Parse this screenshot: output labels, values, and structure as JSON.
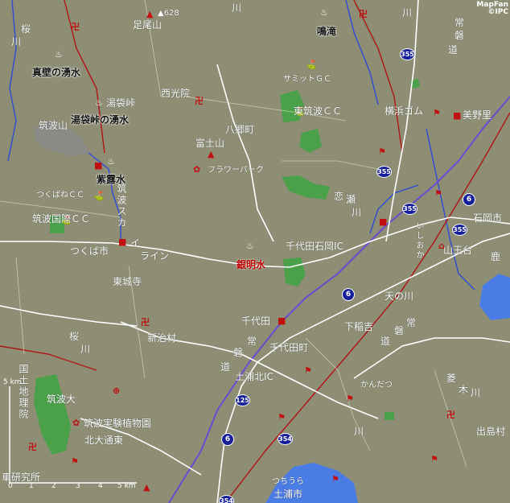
{
  "credit": {
    "line1": "MapFan",
    "line2": "©IPC"
  },
  "roads": {
    "r355a": "355",
    "r355b": "355",
    "r355c": "355",
    "r355d": "355",
    "r6a": "6",
    "r6b": "6",
    "r6c": "6",
    "r354": "354",
    "r354b": "354",
    "r125": "125"
  },
  "places": {
    "ashio": "足尾山",
    "peak628": "▲628",
    "naruto": "鳴滝",
    "sakuragawa1": "桜",
    "sakuragawa2": "川",
    "kawa_top": "川",
    "makabe": "真壁の湧水",
    "yubukuro": "湯袋峠",
    "yubukuro_spring": "湯袋峠の湧水",
    "tsukubasan": "筑波山",
    "saikouin": "西光院",
    "summit_cc": "サミットＧＣ",
    "higashi_tsukuba_cc": "東筑波ＣＣ",
    "yokohama_rubber": "横浜ゴム",
    "minori": "美野里",
    "yasato": "八郷町",
    "fujisan": "富士山",
    "flowerpark": "フラワーパーク",
    "shishisui": "紫露水",
    "tsukubane_cc": "つくばねＣＣ",
    "tsukuba_kokusai_cc": "筑波国際ＣＣ",
    "tsukuba_line": "つくば市",
    "higashijoji": "東城寺",
    "koise": "恋",
    "koise2": "瀬",
    "koise3": "川",
    "ishioka_city": "石岡市",
    "sannoudai": "山王台",
    "kashima": "鹿",
    "ishioka_ic": "千代田石岡IC",
    "ginmeisui": "銀明水",
    "tennokawa": "天の川",
    "chiyoda": "千代田",
    "chiyoda_town": "千代田町",
    "shimoinayoshi": "下稲吉",
    "niiharu": "新治村",
    "tsuchiura_kita_ic": "土浦北IC",
    "kandatsu": "かんだつ",
    "hishiki1": "菱",
    "hishiki2": "木",
    "hishiki3": "川",
    "dejima": "出島村",
    "tsukuba_dai": "筑波大",
    "tsukuba_botanical": "筑波実験植物園",
    "hokudai": "北大通東",
    "tsuchiura": "土浦市",
    "tsuchiura_kana": "つちうら",
    "kokudo": "国土地理院",
    "kenkyusho": "車研究所",
    "sakura2": "桜",
    "sakura3": "川",
    "ishioka_kana": "いしおか",
    "tsukuba_line_v": "筑波スカ",
    "line_i": "イ",
    "line_rain": "ライン",
    "jouban1": "常",
    "jouban2": "磐",
    "jouban3": "道",
    "jouban4": "常",
    "jouban5": "磐",
    "jouban6": "道",
    "jouban7": "常",
    "jouban8": "磐",
    "jouban9": "道",
    "river_1": "川",
    "river_2": "川"
  },
  "scale": {
    "unit_top": "5 km",
    "t0": "0",
    "t1": "1",
    "t2": "2",
    "t3": "3",
    "t4": "4",
    "t5": "5 km"
  }
}
